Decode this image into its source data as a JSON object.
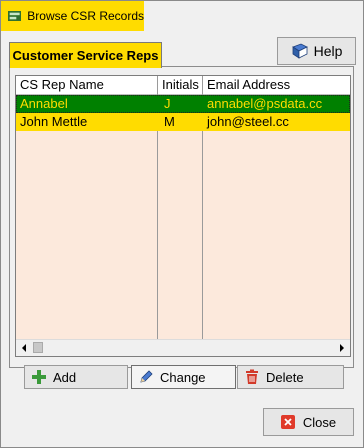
{
  "window": {
    "title": "Browse CSR Records"
  },
  "tab": {
    "label": "Customer Service Reps"
  },
  "help": {
    "label": "Help"
  },
  "list": {
    "columns": [
      "CS Rep Name",
      "Initials",
      "Email Address"
    ],
    "rows": [
      {
        "name": "Annabel",
        "initials": "J",
        "email": "annabel@psdata.cc",
        "selected": true
      },
      {
        "name": "John Mettle",
        "initials": "M",
        "email": "john@steel.cc",
        "selected": false
      }
    ]
  },
  "buttons": {
    "add": "Add",
    "change": "Change",
    "delete": "Delete",
    "close": "Close"
  },
  "colors": {
    "accent_yellow": "#ffdc00",
    "selected_green": "#008000",
    "list_bg": "#fce9dc"
  }
}
